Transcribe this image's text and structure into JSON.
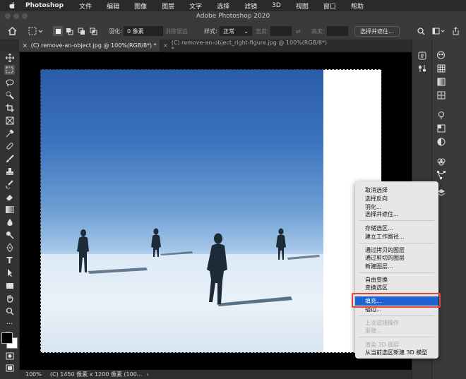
{
  "menubar": {
    "app_name": "Photoshop",
    "items": [
      "文件",
      "编辑",
      "图像",
      "图层",
      "文字",
      "选择",
      "滤镜",
      "3D",
      "视图",
      "窗口",
      "帮助"
    ]
  },
  "window": {
    "title": "Adobe Photoshop 2020"
  },
  "options": {
    "feather_label": "羽化:",
    "feather_value": "0 像素",
    "antialias_label": "消除锯齿",
    "style_label": "样式:",
    "style_value": "正常",
    "width_label": "宽度:",
    "height_label": "高度:",
    "select_mask_label": "选择并遮住..."
  },
  "tabs": [
    {
      "label": "(C) remove-an-object.jpg @ 100%(RGB/8*) *",
      "active": true
    },
    {
      "label": "(C) remove-an-object_right-figure.jpg @ 100%(RGB/8*) *",
      "active": false
    }
  ],
  "status": {
    "zoom": "100%",
    "info": "(C) 1450 像素 x 1200 像素 (100...",
    "arrow": "›"
  },
  "context_menu": {
    "groups": [
      [
        {
          "label": "取消选择",
          "enabled": true
        },
        {
          "label": "选择反向",
          "enabled": true
        },
        {
          "label": "羽化...",
          "enabled": true
        },
        {
          "label": "选择并遮住...",
          "enabled": true
        }
      ],
      [
        {
          "label": "存储选区...",
          "enabled": true
        },
        {
          "label": "建立工作路径...",
          "enabled": true
        }
      ],
      [
        {
          "label": "通过拷贝的图层",
          "enabled": true
        },
        {
          "label": "通过剪切的图层",
          "enabled": true
        },
        {
          "label": "新建图层...",
          "enabled": true
        }
      ],
      [
        {
          "label": "自由变换",
          "enabled": true
        },
        {
          "label": "变换选区",
          "enabled": true
        }
      ],
      [
        {
          "label": "填充...",
          "enabled": true,
          "highlighted": true
        },
        {
          "label": "描边...",
          "enabled": true
        }
      ],
      [
        {
          "label": "上次滤镜操作",
          "enabled": false
        },
        {
          "label": "渐隐...",
          "enabled": false
        }
      ],
      [
        {
          "label": "渲染 3D 图层",
          "enabled": false
        },
        {
          "label": "从当前选区新建 3D 模型",
          "enabled": true
        }
      ]
    ]
  },
  "colors": {
    "highlight": "#1f63d2",
    "callout_box": "#e0463a",
    "sky_top": "#2a5caa",
    "ground": "#e8f1f9"
  },
  "icons": {
    "toolbar": [
      "move-icon",
      "marquee-icon",
      "lasso-icon",
      "quick-select-icon",
      "crop-icon",
      "frame-icon",
      "eyedropper-icon",
      "healing-icon",
      "brush-icon",
      "clone-stamp-icon",
      "history-brush-icon",
      "eraser-icon",
      "gradient-icon",
      "blur-icon",
      "dodge-icon",
      "pen-icon",
      "type-icon",
      "path-select-icon",
      "rectangle-icon",
      "hand-icon",
      "zoom-icon",
      "more-tools-icon"
    ]
  }
}
